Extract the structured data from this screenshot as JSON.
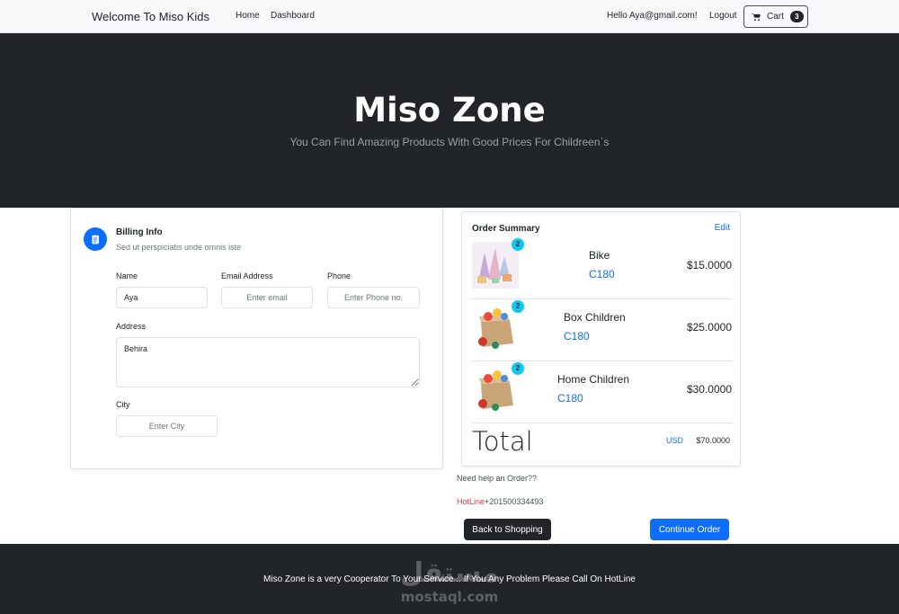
{
  "navbar": {
    "brand": "Welcome To Miso Kids",
    "links": [
      "Home",
      "Dashboard"
    ],
    "greeting": "Hello Aya@gmail.com!",
    "logout": "Logout",
    "cart_label": "Cart",
    "cart_count": "3"
  },
  "hero": {
    "title": "Miso Zone",
    "subtitle": "You Can Find Amazing Products With Good Prices For Childreen`s"
  },
  "billing": {
    "title": "Billing Info",
    "subtitle": "Sed ut perspiciatis unde omnis iste",
    "name_label": "Name",
    "name_value": "Aya",
    "email_label": "Email Address",
    "email_placeholder": "Enter email",
    "phone_label": "Phone",
    "phone_placeholder": "Enter Phone no.",
    "address_label": "Address",
    "address_value": "Behira",
    "city_label": "City",
    "city_placeholder": "Enter City"
  },
  "summary": {
    "title": "Order Summary",
    "edit": "Edit",
    "items": [
      {
        "name": "Bike",
        "code": "C180",
        "price": "$15.0000",
        "qty": "2",
        "image": "bike-toy"
      },
      {
        "name": "Box Children",
        "code": "C180",
        "price": "$25.0000",
        "qty": "2",
        "image": "toy-box"
      },
      {
        "name": "Home Children",
        "code": "C180",
        "price": "$30.0000",
        "qty": "2",
        "image": "toy-box"
      }
    ],
    "total_label": "Total",
    "currency": "USD",
    "total_value": "$70.0000"
  },
  "help": {
    "question": "Need help an Order??",
    "hotline_label": "HotLine",
    "hotline_number": "+201500334493"
  },
  "buttons": {
    "back": "Back to Shopping",
    "continue": "Continue Order"
  },
  "footer": {
    "text": "Miso Zone is a very Cooperator To Your Service .. If You Any Problem Please Call On HotLine"
  },
  "watermark": {
    "arabic": "مستقل",
    "latin": "mostaql.com"
  },
  "colors": {
    "primary": "#0d6efd",
    "dark": "#212529",
    "info": "#0dcaf0",
    "danger": "#dc3545"
  }
}
